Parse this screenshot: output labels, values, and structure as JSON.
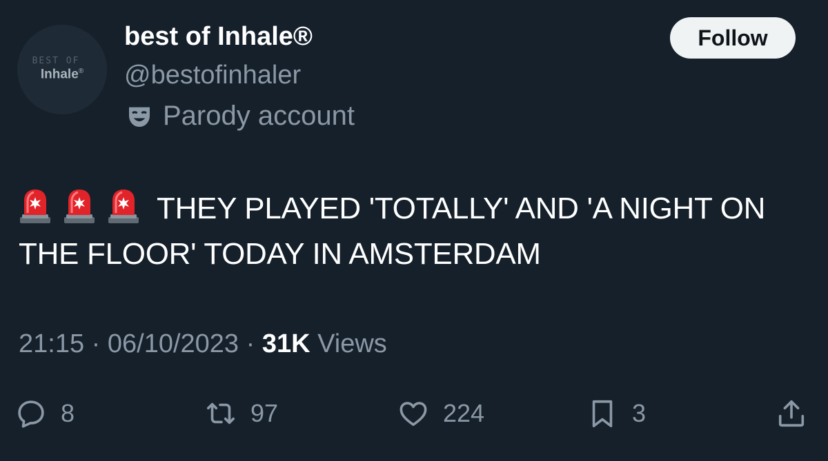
{
  "account": {
    "avatar_small_text": "BEST OF",
    "avatar_big_text": "Inhale",
    "avatar_mark": "®",
    "display_name": "best of Inhale®",
    "handle": "@bestofinhaler",
    "label_icon": "mask-icon",
    "label": "Parody account"
  },
  "follow_button": {
    "label": "Follow"
  },
  "tweet": {
    "emoji_icons": [
      "police-siren-icon",
      "police-siren-icon",
      "police-siren-icon"
    ],
    "text": "THEY PLAYED 'TOTALLY' AND 'A NIGHT ON THE FLOOR' TODAY IN AMSTERDAM"
  },
  "meta": {
    "time": "21:15",
    "separator": "·",
    "date": "06/10/2023",
    "views_count": "31K",
    "views_label": "Views"
  },
  "actions": {
    "replies": {
      "icon": "reply-icon",
      "count": "8"
    },
    "reposts": {
      "icon": "repost-icon",
      "count": "97"
    },
    "likes": {
      "icon": "heart-icon",
      "count": "224"
    },
    "bookmarks": {
      "icon": "bookmark-icon",
      "count": "3"
    },
    "share": {
      "icon": "share-icon"
    }
  },
  "colors": {
    "background": "#15202b",
    "text_primary": "#ffffff",
    "text_secondary": "#8b98a5",
    "button_bg": "#eff3f4",
    "button_text": "#0f1419",
    "siren_red": "#e0242a"
  }
}
